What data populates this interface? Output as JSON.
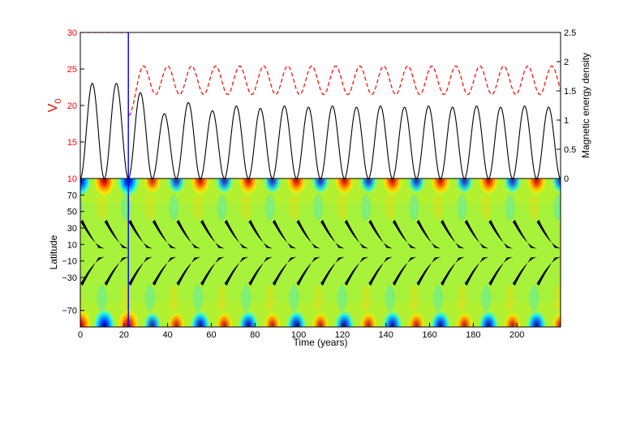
{
  "chart_data": [
    {
      "type": "line",
      "panel": "top",
      "xlim": [
        0,
        220
      ],
      "ylim_left": [
        10,
        30
      ],
      "ylim_right": [
        0,
        2.5
      ],
      "left_axis": {
        "label_main": "V",
        "label_sub": "0",
        "color": "#ff0000",
        "ticks": [
          {
            "v": 10,
            "t": "10"
          },
          {
            "v": 15,
            "t": "15"
          },
          {
            "v": 20,
            "t": "20"
          },
          {
            "v": 25,
            "t": "25"
          },
          {
            "v": 30,
            "t": "30"
          }
        ]
      },
      "right_axis": {
        "label": "Magnetic energy density",
        "color": "#000000",
        "ticks": [
          {
            "v": 0,
            "t": "0"
          },
          {
            "v": 0.5,
            "t": "0.5"
          },
          {
            "v": 1,
            "t": "1"
          },
          {
            "v": 1.5,
            "t": "1.5"
          },
          {
            "v": 2,
            "t": "2"
          },
          {
            "v": 2.5,
            "t": "2.5"
          }
        ]
      },
      "series": [
        {
          "axis": "left",
          "color": "#ff0000",
          "style": "dashed",
          "segments": [
            {
              "x": [
                0,
                22
              ],
              "y": [
                30,
                30
              ]
            },
            {
              "x": [
                22,
                22
              ],
              "y": [
                30,
                18.6
              ]
            },
            {
              "type": "sine",
              "x_start": 22,
              "x_end": 220,
              "y_start": 18.6,
              "y_low": 21.5,
              "y_high": 25.4,
              "first_peak_x": 29,
              "period": 11
            }
          ]
        },
        {
          "axis": "right",
          "color": "#000000",
          "style": "solid",
          "cycles": [
            {
              "x_start": 0,
              "x_end": 11,
              "peak": 1.63
            },
            {
              "x_start": 11,
              "x_end": 22,
              "peak": 1.63
            },
            {
              "x_start": 22,
              "x_end": 33,
              "peak": 1.47
            },
            {
              "x_start": 33,
              "x_end": 44,
              "peak": 1.11
            },
            {
              "x_start": 44,
              "x_end": 55,
              "peak": 1.3
            },
            {
              "x_start": 55,
              "x_end": 66,
              "peak": 1.16
            },
            {
              "x_start": 66,
              "x_end": 77,
              "peak": 1.24
            },
            {
              "x_start": 77,
              "x_end": 88,
              "peak": 1.2
            },
            {
              "x_start": 88,
              "x_end": 99,
              "peak": 1.24
            },
            {
              "x_start": 99,
              "x_end": 110,
              "peak": 1.22
            },
            {
              "x_start": 110,
              "x_end": 121,
              "peak": 1.24
            },
            {
              "x_start": 121,
              "x_end": 132,
              "peak": 1.22
            },
            {
              "x_start": 132,
              "x_end": 143,
              "peak": 1.24
            },
            {
              "x_start": 143,
              "x_end": 154,
              "peak": 1.22
            },
            {
              "x_start": 154,
              "x_end": 165,
              "peak": 1.24
            },
            {
              "x_start": 165,
              "x_end": 176,
              "peak": 1.22
            },
            {
              "x_start": 176,
              "x_end": 187,
              "peak": 1.24
            },
            {
              "x_start": 187,
              "x_end": 198,
              "peak": 1.22
            },
            {
              "x_start": 198,
              "x_end": 209,
              "peak": 1.24
            },
            {
              "x_start": 209,
              "x_end": 220,
              "peak": 1.22
            }
          ]
        },
        {
          "axis": "left",
          "color": "#0000ff",
          "style": "solid",
          "segments": [
            {
              "x": [
                22,
                22
              ],
              "y": [
                10,
                30
              ]
            }
          ]
        }
      ]
    },
    {
      "type": "heatmap",
      "panel": "bottom",
      "title": "",
      "xlabel": "Time (years)",
      "ylabel": "Latitude",
      "xlim": [
        0,
        220
      ],
      "ylim": [
        -90,
        90
      ],
      "background_color": "#a7f23a",
      "x_ticks": [
        {
          "v": 0,
          "t": "0"
        },
        {
          "v": 20,
          "t": "20"
        },
        {
          "v": 40,
          "t": "40"
        },
        {
          "v": 60,
          "t": "60"
        },
        {
          "v": 80,
          "t": "80"
        },
        {
          "v": 100,
          "t": "100"
        },
        {
          "v": 120,
          "t": "120"
        },
        {
          "v": 140,
          "t": "140"
        },
        {
          "v": 160,
          "t": "160"
        },
        {
          "v": 180,
          "t": "180"
        },
        {
          "v": 200,
          "t": "200"
        }
      ],
      "y_ticks": [
        {
          "v": 70,
          "t": "70"
        },
        {
          "v": 50,
          "t": "50"
        },
        {
          "v": 30,
          "t": "30"
        },
        {
          "v": 10,
          "t": "10"
        },
        {
          "v": -10,
          "t": "−10"
        },
        {
          "v": -30,
          "t": "−30"
        },
        {
          "v": -70,
          "t": "−70"
        }
      ],
      "polar_blobs": [
        {
          "x": 0,
          "polarity": "negative",
          "strength": 1.0
        },
        {
          "x": 11,
          "polarity": "positive",
          "strength": 1.0
        },
        {
          "x": 22,
          "polarity": "negative",
          "strength": 1.0
        },
        {
          "x": 33,
          "polarity": "positive",
          "strength": 0.6
        },
        {
          "x": 44,
          "polarity": "negative",
          "strength": 0.6
        },
        {
          "x": 55,
          "polarity": "positive",
          "strength": 0.8
        },
        {
          "x": 66,
          "polarity": "negative",
          "strength": 0.6
        },
        {
          "x": 77,
          "polarity": "positive",
          "strength": 0.8
        },
        {
          "x": 88,
          "polarity": "negative",
          "strength": 0.6
        },
        {
          "x": 99,
          "polarity": "positive",
          "strength": 0.8
        },
        {
          "x": 110,
          "polarity": "negative",
          "strength": 0.6
        },
        {
          "x": 121,
          "polarity": "positive",
          "strength": 0.8
        },
        {
          "x": 132,
          "polarity": "negative",
          "strength": 0.6
        },
        {
          "x": 143,
          "polarity": "positive",
          "strength": 0.8
        },
        {
          "x": 154,
          "polarity": "negative",
          "strength": 0.6
        },
        {
          "x": 165,
          "polarity": "positive",
          "strength": 0.8
        },
        {
          "x": 176,
          "polarity": "negative",
          "strength": 0.6
        },
        {
          "x": 187,
          "polarity": "positive",
          "strength": 0.8
        },
        {
          "x": 198,
          "polarity": "negative",
          "strength": 0.6
        },
        {
          "x": 209,
          "polarity": "positive",
          "strength": 0.8
        },
        {
          "x": 220,
          "polarity": "negative",
          "strength": 0.6
        }
      ],
      "butterfly_wings": {
        "x_starts": [
          0,
          11,
          22,
          33,
          44,
          55,
          66,
          77,
          88,
          99,
          110,
          121,
          132,
          143,
          154,
          165,
          176,
          187,
          198,
          209
        ],
        "duration": 11,
        "lat_start": 37,
        "lat_end": 5,
        "color": "#000000"
      },
      "marker_line": {
        "x": 22,
        "color": "#0000ff"
      }
    }
  ]
}
